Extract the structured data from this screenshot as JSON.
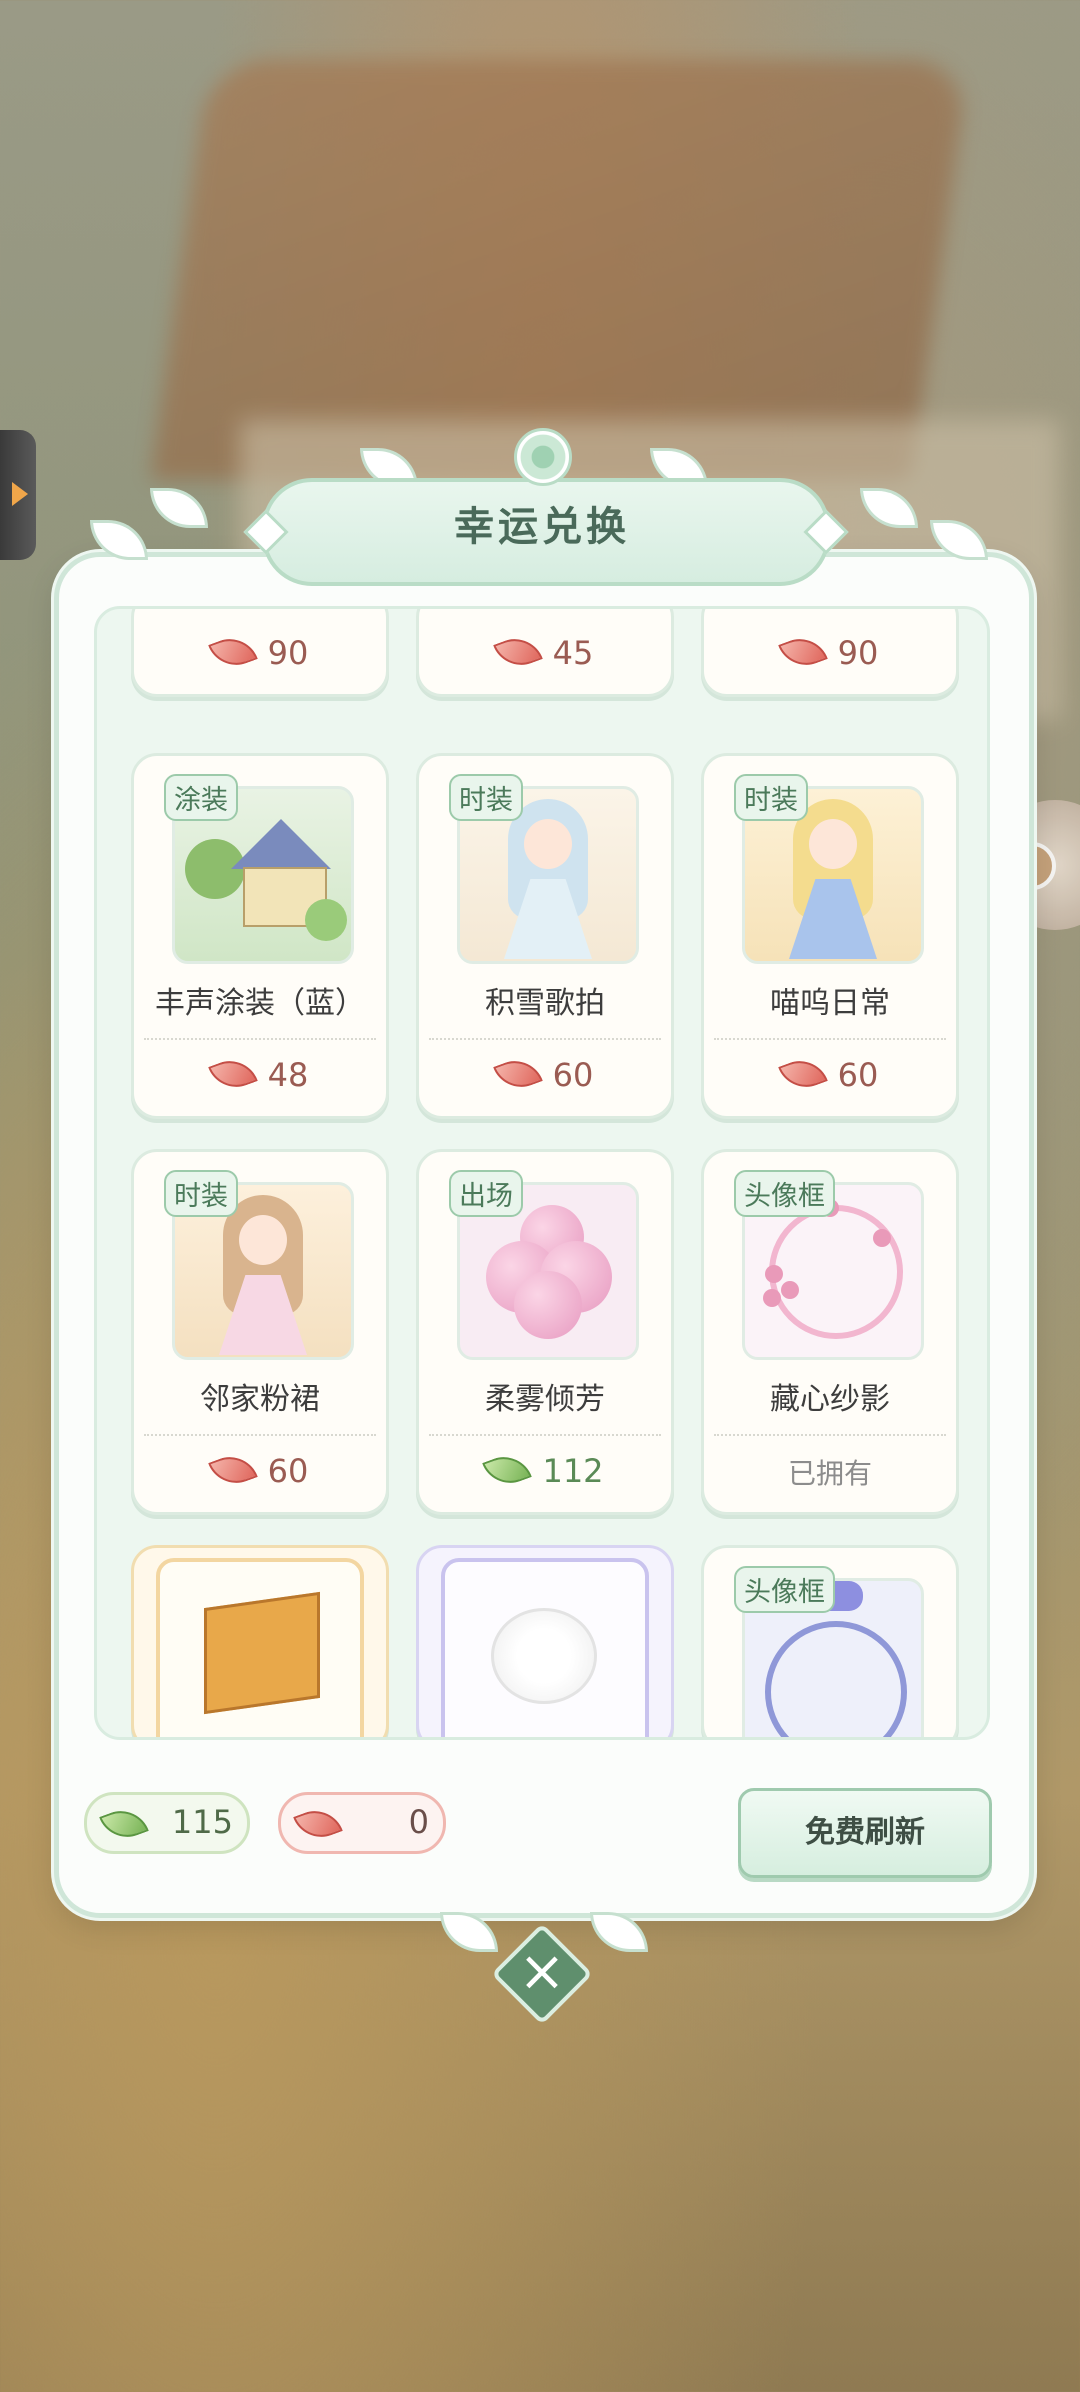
{
  "dialog": {
    "title": "幸运兑换"
  },
  "top_row": [
    {
      "price": "90",
      "currency": "red"
    },
    {
      "price": "45",
      "currency": "red"
    },
    {
      "price": "90",
      "currency": "red"
    }
  ],
  "items": [
    {
      "tag": "涂装",
      "name": "丰声涂装（蓝）",
      "price": "48",
      "currency": "red",
      "icon": "house-icon"
    },
    {
      "tag": "时装",
      "name": "积雪歌拍",
      "price": "60",
      "currency": "red",
      "icon": "snow-dress-icon"
    },
    {
      "tag": "时装",
      "name": "喵呜日常",
      "price": "60",
      "currency": "red",
      "icon": "cat-outfit-icon"
    },
    {
      "tag": "时装",
      "name": "邻家粉裙",
      "price": "60",
      "currency": "red",
      "icon": "pink-dress-icon"
    },
    {
      "tag": "出场",
      "name": "柔雾倾芳",
      "price": "112",
      "currency": "green",
      "icon": "balloon-icon"
    },
    {
      "tag": "头像框",
      "name": "藏心纱影",
      "price": "已拥有",
      "currency": "none",
      "icon": "pink-frame-icon"
    }
  ],
  "bottom_row": [
    {
      "tag": "",
      "icon": "crate-icon"
    },
    {
      "tag": "",
      "icon": "cloud-icon"
    },
    {
      "tag": "头像框",
      "icon": "blue-frame-icon"
    }
  ],
  "footer": {
    "green_currency": "115",
    "red_currency": "0",
    "refresh_label": "免费刷新",
    "close_symbol": "×"
  },
  "colors": {
    "panel_border": "#cfe6d8",
    "accent_green": "#5f8f6d",
    "price_red": "#9a5b52"
  }
}
